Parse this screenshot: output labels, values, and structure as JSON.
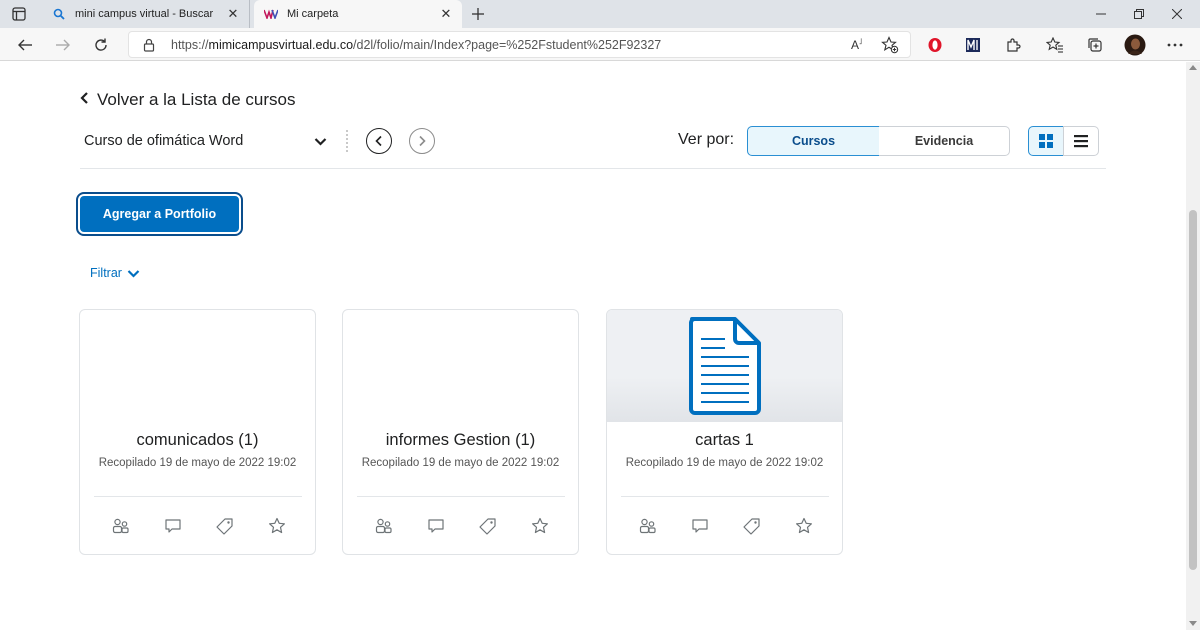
{
  "browser": {
    "tabs": [
      {
        "title": "mini campus virtual - Buscar",
        "favicon": "search-icon"
      },
      {
        "title": "Mi carpeta",
        "favicon": "site-logo-icon"
      }
    ],
    "url": {
      "scheme": "https://",
      "host": "mimicampusvirtual.edu.co",
      "path": "/d2l/folio/main/Index?page=%252Fstudent%252F92327"
    }
  },
  "page": {
    "back_link": "Volver a la Lista de cursos",
    "course_select": "Curso de ofimática Word",
    "view_by_label": "Ver por:",
    "view_options": [
      "Cursos",
      "Evidencia"
    ],
    "selected_view": "Cursos",
    "layout_mode": "grid",
    "add_button": "Agregar a Portfolio",
    "filter_label": "Filtrar",
    "cards": [
      {
        "title": "comunicados (1)",
        "date": "Recopilado 19 de mayo de 2022 19:02",
        "thumbnail": "none"
      },
      {
        "title": "informes Gestion (1)",
        "date": "Recopilado 19 de mayo de 2022 19:02",
        "thumbnail": "none"
      },
      {
        "title": "cartas 1",
        "date": "Recopilado 19 de mayo de 2022 19:02",
        "thumbnail": "document-icon"
      }
    ],
    "card_actions": [
      "share-icon",
      "comment-icon",
      "tag-icon",
      "star-icon"
    ]
  },
  "colors": {
    "primary": "#006fbf",
    "primary_dark": "#0a4d8c",
    "selected_bg": "#e8f6fc",
    "text": "#202122"
  }
}
